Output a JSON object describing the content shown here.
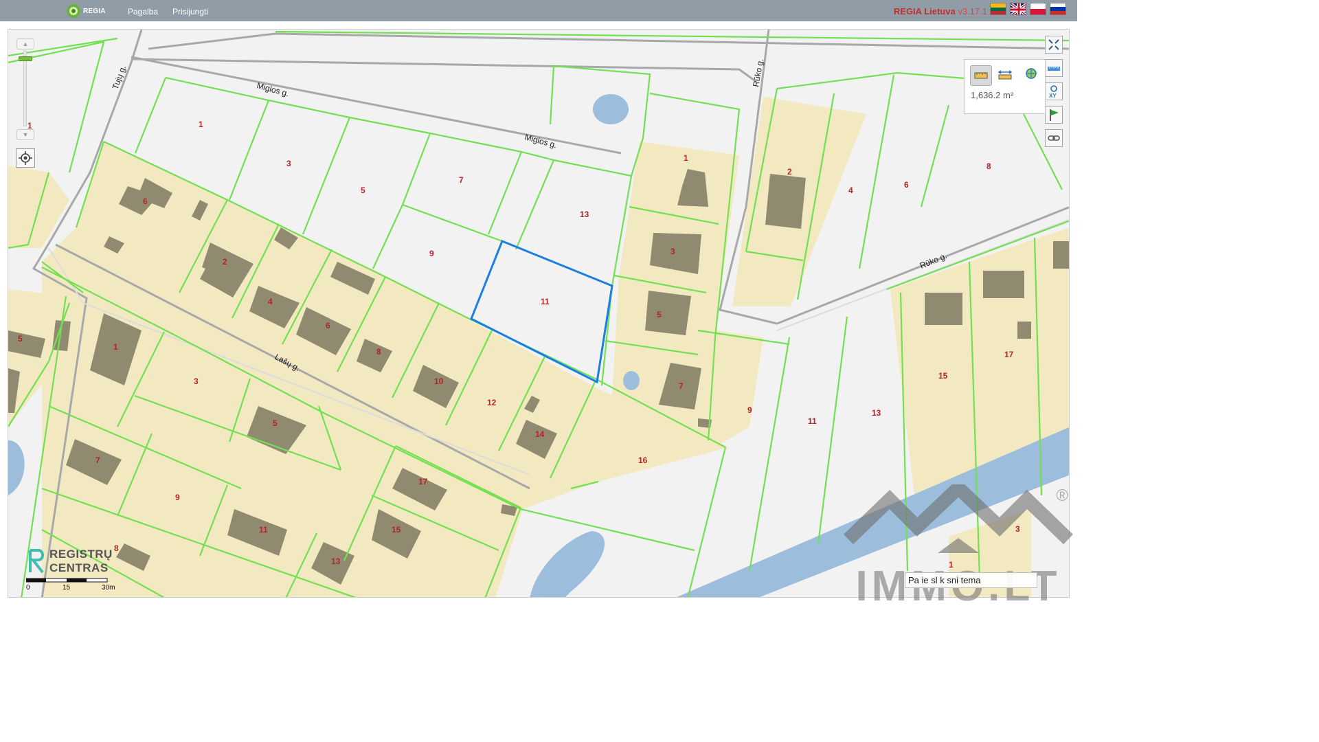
{
  "header": {
    "logo_text": "REGIA",
    "nav": [
      "Pagalba",
      "Prisijungti"
    ],
    "brand_name": "REGIA Lietuva",
    "version": "v3.17.1",
    "languages": [
      {
        "name": "lithuanian-flag-icon",
        "colors": [
          "#fdb913",
          "#006a44",
          "#c1272d"
        ]
      },
      {
        "name": "uk-flag-icon",
        "colors": [
          "#012169",
          "#ffffff",
          "#c8102e"
        ]
      },
      {
        "name": "polish-flag-icon",
        "colors": [
          "#ffffff",
          "#dc143c"
        ]
      },
      {
        "name": "russian-flag-icon",
        "colors": [
          "#ffffff",
          "#0039a6",
          "#d52b1e"
        ]
      }
    ]
  },
  "map": {
    "zoom_level": "1",
    "measurement": "1,636.2 m²",
    "selected_parcel": "11",
    "streets": [
      "Miglos g.",
      "Miglos g.",
      "Tujų g.",
      "Rūko g.",
      "Rūko g.",
      "Lašų g."
    ],
    "parcel_labels": [
      "1",
      "3",
      "5",
      "7",
      "9",
      "11",
      "13",
      "6",
      "2",
      "4",
      "6",
      "8",
      "10",
      "12",
      "14",
      "1",
      "3",
      "5",
      "7",
      "9",
      "16",
      "2",
      "4",
      "6",
      "8",
      "11",
      "13",
      "15",
      "17",
      "1",
      "3",
      "5",
      "7",
      "9",
      "11",
      "13",
      "15",
      "17",
      "5",
      "8",
      "3",
      "1"
    ],
    "layer_search_placeholder": "Paieška sluoksnių tema",
    "layer_search_value": "Pa ie sl k sni tema",
    "colors": {
      "parcel_border": "#72e052",
      "built_area": "#f3e9c1",
      "building": "#8f8a70",
      "water": "#9cbddc",
      "road": "#a8a8a8",
      "selection": "#1a7fe0",
      "label": "#b4232a"
    }
  },
  "footer": {
    "org_line1": "REGISTRŲ",
    "org_line2": "CENTRAS",
    "scale": [
      "0",
      "15",
      "30m"
    ],
    "watermark": "IMMO.LT",
    "registered": "®"
  }
}
